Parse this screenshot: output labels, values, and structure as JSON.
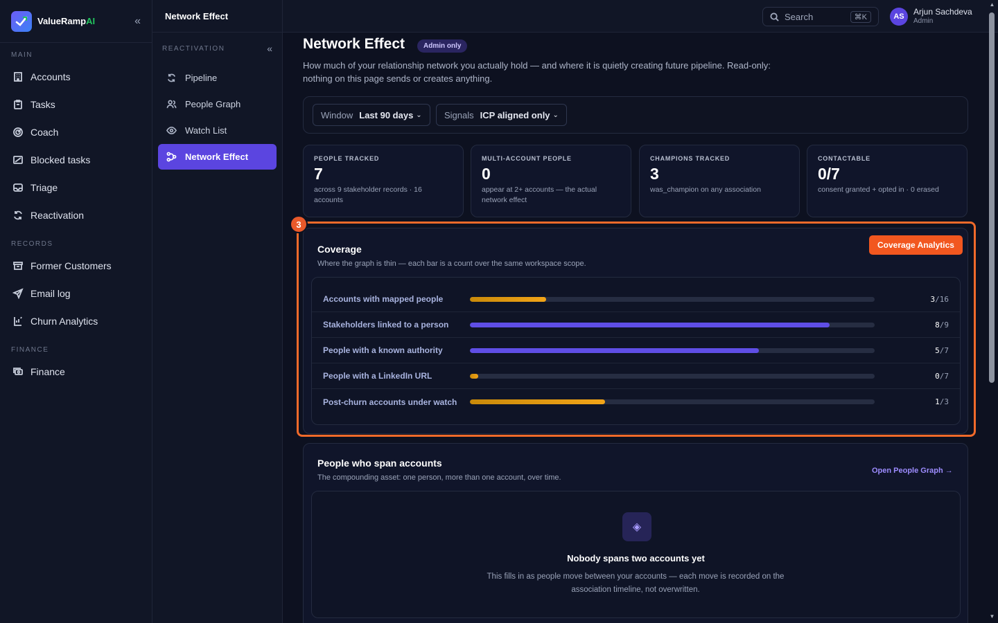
{
  "brand": {
    "name_main": "ValueRamp",
    "name_accent": "AI"
  },
  "sidebar": {
    "sections": [
      {
        "title": "MAIN",
        "items": [
          {
            "label": "Accounts",
            "icon": "building-icon"
          },
          {
            "label": "Tasks",
            "icon": "clipboard-icon"
          },
          {
            "label": "Coach",
            "icon": "target-icon"
          },
          {
            "label": "Blocked tasks",
            "icon": "blocked-icon"
          },
          {
            "label": "Triage",
            "icon": "inbox-icon"
          },
          {
            "label": "Reactivation",
            "icon": "refresh-icon"
          }
        ]
      },
      {
        "title": "RECORDS",
        "items": [
          {
            "label": "Former Customers",
            "icon": "archive-icon"
          },
          {
            "label": "Email log",
            "icon": "send-icon"
          },
          {
            "label": "Churn Analytics",
            "icon": "chart-icon"
          }
        ]
      },
      {
        "title": "FINANCE",
        "items": [
          {
            "label": "Finance",
            "icon": "money-icon"
          }
        ]
      }
    ]
  },
  "subsidebar": {
    "header": "Network Effect",
    "section_label": "REACTIVATION",
    "items": [
      {
        "label": "Pipeline",
        "icon": "refresh-icon"
      },
      {
        "label": "People Graph",
        "icon": "users-icon"
      },
      {
        "label": "Watch List",
        "icon": "eye-icon"
      },
      {
        "label": "Network Effect",
        "icon": "network-icon",
        "active": true
      }
    ]
  },
  "topbar": {
    "search_placeholder": "Search",
    "shortcut": "⌘K",
    "user": {
      "initials": "AS",
      "name": "Arjun Sachdeva",
      "role": "Admin"
    }
  },
  "page": {
    "title": "Network Effect",
    "badge": "Admin only",
    "description": "How much of your relationship network you actually hold — and where it is quietly creating future pipeline. Read-only: nothing on this page sends or creates anything."
  },
  "filters": [
    {
      "key": "Window",
      "value": "Last 90 days"
    },
    {
      "key": "Signals",
      "value": "ICP aligned only"
    }
  ],
  "stats": [
    {
      "label": "PEOPLE TRACKED",
      "value": "7",
      "sub": "across 9 stakeholder records · 16 accounts"
    },
    {
      "label": "MULTI-ACCOUNT PEOPLE",
      "value": "0",
      "sub": "appear at 2+ accounts — the actual network effect"
    },
    {
      "label": "CHAMPIONS TRACKED",
      "value": "3",
      "sub": "was_champion on any association"
    },
    {
      "label": "CONTACTABLE",
      "value": "0/7",
      "sub": "consent granted + opted in · 0 erased"
    }
  ],
  "coverage": {
    "marker": "3",
    "title": "Coverage",
    "subtitle": "Where the graph is thin — each bar is a count over the same workspace scope.",
    "button": "Coverage Analytics",
    "rows": [
      {
        "label": "Accounts with mapped people",
        "num": 3,
        "den": 16,
        "color": "#f2a418"
      },
      {
        "label": "Stakeholders linked to a person",
        "num": 8,
        "den": 9,
        "color": "#5f4ee6"
      },
      {
        "label": "People with a known authority",
        "num": 5,
        "den": 7,
        "color": "#5f4ee6"
      },
      {
        "label": "People with a LinkedIn URL",
        "num": 0,
        "den": 7,
        "color": "#f2a418"
      },
      {
        "label": "Post-churn accounts under watch",
        "num": 1,
        "den": 3,
        "color": "#f2a418"
      }
    ]
  },
  "span": {
    "title": "People who span accounts",
    "subtitle": "The compounding asset: one person, more than one account, over time.",
    "link": "Open People Graph →",
    "empty_title": "Nobody spans two accounts yet",
    "empty_desc": "This fills in as people move between your accounts — each move is recorded on the association timeline, not overwritten."
  }
}
